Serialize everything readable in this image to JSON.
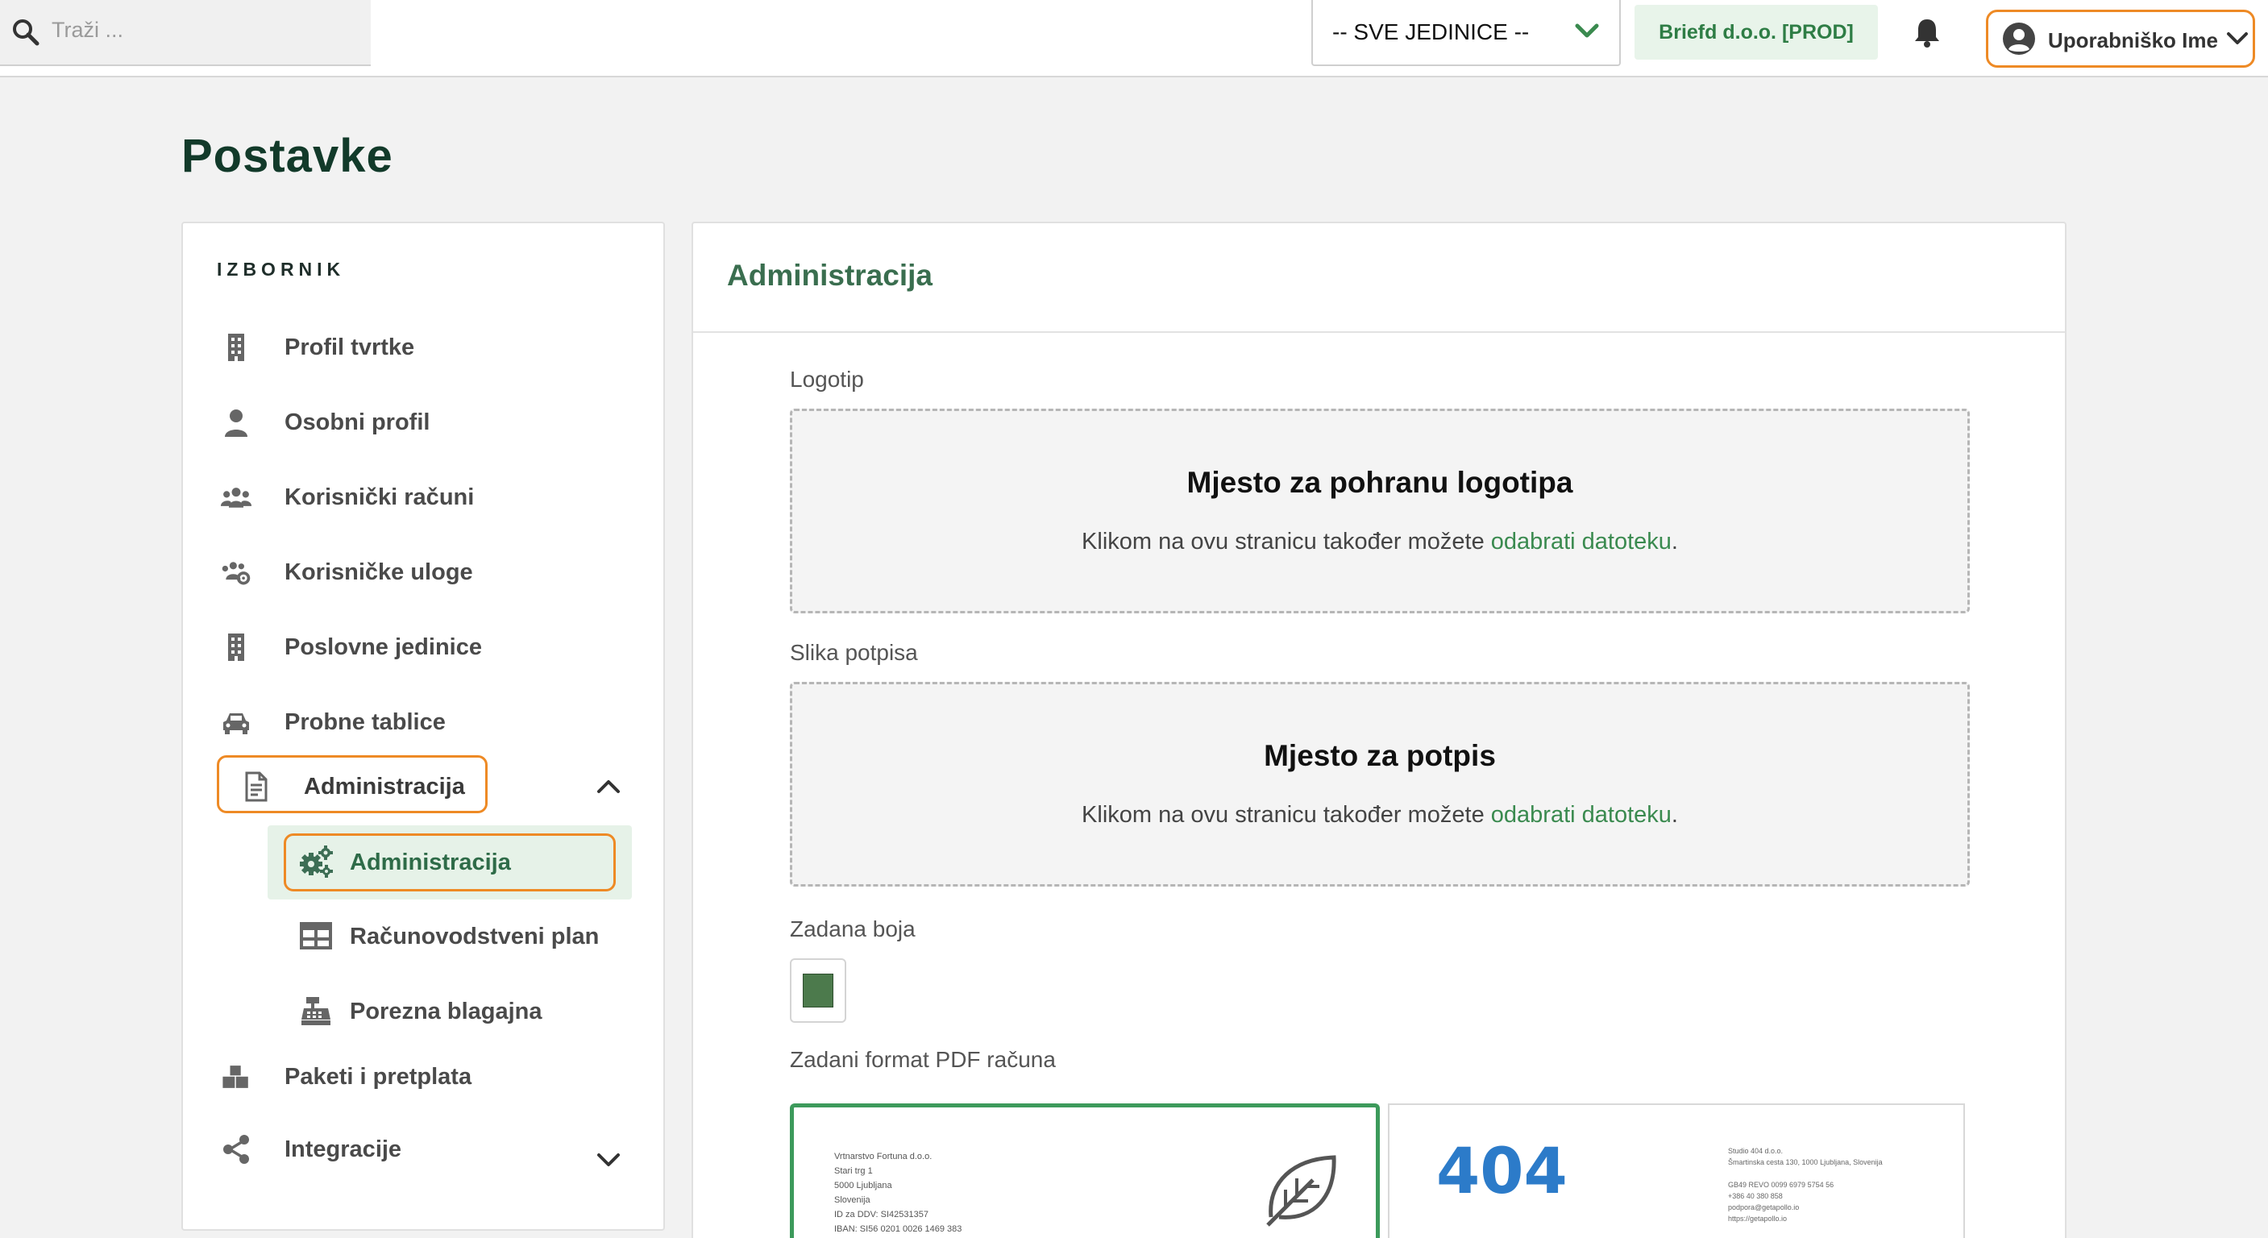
{
  "topbar": {
    "search_placeholder": "Traži ...",
    "unit_select_value": "-- SVE JEDINICE --",
    "company_badge": "Briefd d.o.o. [PROD]",
    "user_name": "Uporabniško Ime"
  },
  "page": {
    "title": "Postavke"
  },
  "menu": {
    "heading": "IZBORNIK",
    "items": [
      {
        "label": "Profil tvrtke",
        "icon": "building-icon"
      },
      {
        "label": "Osobni profil",
        "icon": "user-icon"
      },
      {
        "label": "Korisnički računi",
        "icon": "users-icon"
      },
      {
        "label": "Korisničke uloge",
        "icon": "users-gear-icon"
      },
      {
        "label": "Poslovne jedinice",
        "icon": "building-icon"
      },
      {
        "label": "Probne tablice",
        "icon": "car-icon"
      },
      {
        "label": "Administracija",
        "icon": "document-icon",
        "expanded": true
      },
      {
        "label": "Paketi i pretplata",
        "icon": "boxes-icon"
      },
      {
        "label": "Integracije",
        "icon": "share-icon",
        "expanded": false
      }
    ],
    "subitems": [
      {
        "label": "Administracija",
        "icon": "gears-icon",
        "active": true
      },
      {
        "label": "Računovodstveni plan",
        "icon": "table-icon"
      },
      {
        "label": "Porezna blagajna",
        "icon": "cash-register-icon"
      }
    ]
  },
  "panel": {
    "title": "Administracija",
    "logo": {
      "label": "Logotip",
      "heading": "Mjesto za pohranu logotipa",
      "text": "Klikom na ovu stranicu također možete ",
      "link": "odabrati datoteku",
      "suffix": "."
    },
    "signature": {
      "label": "Slika potpisa",
      "heading": "Mjesto za potpis",
      "text": "Klikom na ovu stranicu također možete ",
      "link": "odabrati datoteku",
      "suffix": "."
    },
    "color": {
      "label": "Zadana boja",
      "value": "#4c7a4c"
    },
    "pdf_format": {
      "label": "Zadani format PDF računa",
      "templates": [
        {
          "lines": [
            "Vrtnarstvo Fortuna d.o.o.",
            "Stari trg 1",
            "5000 Ljubljana",
            "Slovenija",
            "ID za DDV: SI42531357",
            "IBAN: SI56 0201 0026 1469 383"
          ],
          "selected": true
        },
        {
          "big": "404",
          "lines": [
            "Studio 404 d.o.o.",
            "Šmartinska cesta 130, 1000 Ljubljana, Slovenija",
            "",
            "GB49 REVO 0099 6979 5754 56",
            "+386 40 380 858",
            "podpora@getapollo.io",
            "https://getapollo.io"
          ],
          "selected": false
        }
      ]
    }
  },
  "colors": {
    "accent": "#3a8a4f",
    "highlight": "#ee8a25",
    "title": "#123a2a"
  }
}
